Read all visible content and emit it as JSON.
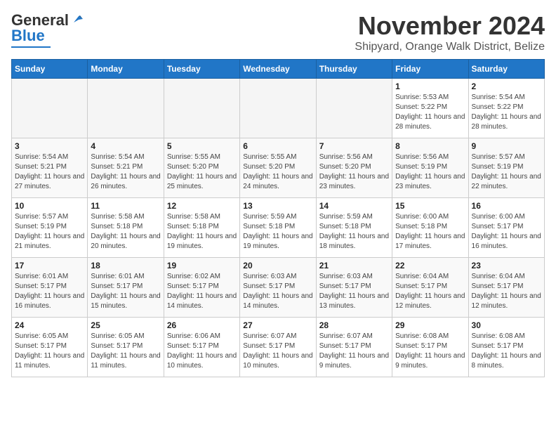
{
  "header": {
    "logo": {
      "line1": "General",
      "line2": "Blue"
    },
    "title": "November 2024",
    "location": "Shipyard, Orange Walk District, Belize"
  },
  "days_of_week": [
    "Sunday",
    "Monday",
    "Tuesday",
    "Wednesday",
    "Thursday",
    "Friday",
    "Saturday"
  ],
  "weeks": [
    [
      {
        "day": "",
        "info": ""
      },
      {
        "day": "",
        "info": ""
      },
      {
        "day": "",
        "info": ""
      },
      {
        "day": "",
        "info": ""
      },
      {
        "day": "",
        "info": ""
      },
      {
        "day": "1",
        "info": "Sunrise: 5:53 AM\nSunset: 5:22 PM\nDaylight: 11 hours and 28 minutes."
      },
      {
        "day": "2",
        "info": "Sunrise: 5:54 AM\nSunset: 5:22 PM\nDaylight: 11 hours and 28 minutes."
      }
    ],
    [
      {
        "day": "3",
        "info": "Sunrise: 5:54 AM\nSunset: 5:21 PM\nDaylight: 11 hours and 27 minutes."
      },
      {
        "day": "4",
        "info": "Sunrise: 5:54 AM\nSunset: 5:21 PM\nDaylight: 11 hours and 26 minutes."
      },
      {
        "day": "5",
        "info": "Sunrise: 5:55 AM\nSunset: 5:20 PM\nDaylight: 11 hours and 25 minutes."
      },
      {
        "day": "6",
        "info": "Sunrise: 5:55 AM\nSunset: 5:20 PM\nDaylight: 11 hours and 24 minutes."
      },
      {
        "day": "7",
        "info": "Sunrise: 5:56 AM\nSunset: 5:20 PM\nDaylight: 11 hours and 23 minutes."
      },
      {
        "day": "8",
        "info": "Sunrise: 5:56 AM\nSunset: 5:19 PM\nDaylight: 11 hours and 23 minutes."
      },
      {
        "day": "9",
        "info": "Sunrise: 5:57 AM\nSunset: 5:19 PM\nDaylight: 11 hours and 22 minutes."
      }
    ],
    [
      {
        "day": "10",
        "info": "Sunrise: 5:57 AM\nSunset: 5:19 PM\nDaylight: 11 hours and 21 minutes."
      },
      {
        "day": "11",
        "info": "Sunrise: 5:58 AM\nSunset: 5:18 PM\nDaylight: 11 hours and 20 minutes."
      },
      {
        "day": "12",
        "info": "Sunrise: 5:58 AM\nSunset: 5:18 PM\nDaylight: 11 hours and 19 minutes."
      },
      {
        "day": "13",
        "info": "Sunrise: 5:59 AM\nSunset: 5:18 PM\nDaylight: 11 hours and 19 minutes."
      },
      {
        "day": "14",
        "info": "Sunrise: 5:59 AM\nSunset: 5:18 PM\nDaylight: 11 hours and 18 minutes."
      },
      {
        "day": "15",
        "info": "Sunrise: 6:00 AM\nSunset: 5:18 PM\nDaylight: 11 hours and 17 minutes."
      },
      {
        "day": "16",
        "info": "Sunrise: 6:00 AM\nSunset: 5:17 PM\nDaylight: 11 hours and 16 minutes."
      }
    ],
    [
      {
        "day": "17",
        "info": "Sunrise: 6:01 AM\nSunset: 5:17 PM\nDaylight: 11 hours and 16 minutes."
      },
      {
        "day": "18",
        "info": "Sunrise: 6:01 AM\nSunset: 5:17 PM\nDaylight: 11 hours and 15 minutes."
      },
      {
        "day": "19",
        "info": "Sunrise: 6:02 AM\nSunset: 5:17 PM\nDaylight: 11 hours and 14 minutes."
      },
      {
        "day": "20",
        "info": "Sunrise: 6:03 AM\nSunset: 5:17 PM\nDaylight: 11 hours and 14 minutes."
      },
      {
        "day": "21",
        "info": "Sunrise: 6:03 AM\nSunset: 5:17 PM\nDaylight: 11 hours and 13 minutes."
      },
      {
        "day": "22",
        "info": "Sunrise: 6:04 AM\nSunset: 5:17 PM\nDaylight: 11 hours and 12 minutes."
      },
      {
        "day": "23",
        "info": "Sunrise: 6:04 AM\nSunset: 5:17 PM\nDaylight: 11 hours and 12 minutes."
      }
    ],
    [
      {
        "day": "24",
        "info": "Sunrise: 6:05 AM\nSunset: 5:17 PM\nDaylight: 11 hours and 11 minutes."
      },
      {
        "day": "25",
        "info": "Sunrise: 6:05 AM\nSunset: 5:17 PM\nDaylight: 11 hours and 11 minutes."
      },
      {
        "day": "26",
        "info": "Sunrise: 6:06 AM\nSunset: 5:17 PM\nDaylight: 11 hours and 10 minutes."
      },
      {
        "day": "27",
        "info": "Sunrise: 6:07 AM\nSunset: 5:17 PM\nDaylight: 11 hours and 10 minutes."
      },
      {
        "day": "28",
        "info": "Sunrise: 6:07 AM\nSunset: 5:17 PM\nDaylight: 11 hours and 9 minutes."
      },
      {
        "day": "29",
        "info": "Sunrise: 6:08 AM\nSunset: 5:17 PM\nDaylight: 11 hours and 9 minutes."
      },
      {
        "day": "30",
        "info": "Sunrise: 6:08 AM\nSunset: 5:17 PM\nDaylight: 11 hours and 8 minutes."
      }
    ]
  ]
}
